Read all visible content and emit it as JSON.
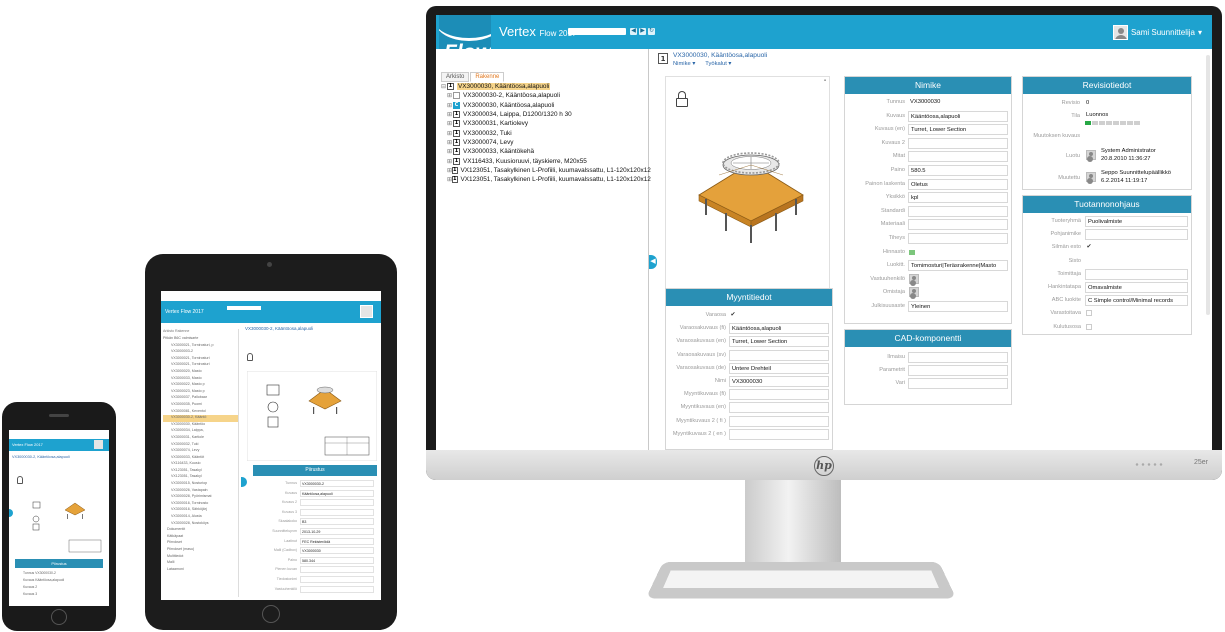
{
  "app": {
    "logo": "Flow",
    "title": "Vertex",
    "version": "Flow 2017",
    "toolbar_icons": [
      "back-icon",
      "forward-icon",
      "refresh-icon"
    ],
    "user_name": "Sami Suunnittelija",
    "user_menu_glyph": "▾"
  },
  "tabs": [
    "Arkisto",
    "Rakenne"
  ],
  "tree": [
    {
      "code": "VX3000030, Kääntöosa,alapuoli",
      "selected": true,
      "level": 0,
      "icon": "item"
    },
    {
      "code": "VX3000030-2, Kääntöosa,alapuoli",
      "level": 1,
      "icon": "doc"
    },
    {
      "code": "VX3000030, Kääntöosa,alapuoli",
      "level": 1,
      "icon": "cad"
    },
    {
      "code": "VX3000034, Laippa, D1200/1320 h 30",
      "level": 1,
      "icon": "item"
    },
    {
      "code": "VX3000031, Kartiolevy",
      "level": 1,
      "icon": "item"
    },
    {
      "code": "VX3000032, Tuki",
      "level": 1,
      "icon": "item"
    },
    {
      "code": "VX3000074, Levy",
      "level": 1,
      "icon": "item"
    },
    {
      "code": "VX3000033, Kääntökehä",
      "level": 1,
      "icon": "item"
    },
    {
      "code": "VX116433, Kuusioruuvi, täyskierre, M20x55",
      "level": 1,
      "icon": "item"
    },
    {
      "code": "VX123051, Tasakylkinen L-Profiili, kuumavalssattu, L1-120x120x12",
      "level": 1,
      "icon": "item"
    },
    {
      "code": "VX123051, Tasakylkinen L-Profiili, kuumavalssattu, L1-120x120x12",
      "level": 1,
      "icon": "item"
    }
  ],
  "header": {
    "title": "VX3000030, Kääntöosa,alapuoli",
    "menu1": "Nimike ▾",
    "menu2": "Työkalut ▾"
  },
  "nimike": {
    "title": "Nimike",
    "rows": [
      {
        "label": "Tunnus",
        "value": "VX3000030",
        "kind": "plain"
      },
      {
        "label": "Kuvaus",
        "value": "Kääntöosa,alapuoli",
        "kind": "box"
      },
      {
        "label": "Kuvaus (en)",
        "value": "Turret, Lower Section",
        "kind": "box"
      },
      {
        "label": "Kuvaus 2",
        "value": "",
        "kind": "box"
      },
      {
        "label": "Mitat",
        "value": "",
        "kind": "box"
      },
      {
        "label": "Paino",
        "value": "580.5",
        "kind": "box"
      },
      {
        "label": "Painon laskenta",
        "value": "Oletus",
        "kind": "box"
      },
      {
        "label": "Yksikkö",
        "value": "kpl",
        "kind": "box"
      },
      {
        "label": "Standardi",
        "value": "",
        "kind": "box"
      },
      {
        "label": "Materiaali",
        "value": "",
        "kind": "box"
      },
      {
        "label": "Tiheys",
        "value": "",
        "kind": "box"
      },
      {
        "label": "Hinnasto",
        "value": "",
        "kind": "green"
      },
      {
        "label": "Luokitt.",
        "value": "Tomimosturi|Teräsrakenne|Masto",
        "kind": "box"
      },
      {
        "label": "Vastuuhenkilö",
        "value": "",
        "kind": "avatar"
      },
      {
        "label": "Omistaja",
        "value": "",
        "kind": "avatar"
      },
      {
        "label": "Julkisuusaste",
        "value": "Yleinen",
        "kind": "box"
      }
    ]
  },
  "revisio": {
    "title": "Revisiotiedot",
    "revisio_label": "Revisio",
    "revisio_value": "0",
    "tila_label": "Tila",
    "tila_value": "Luonnos",
    "tila_progress": 0.125,
    "muutos_label": "Muutoksen kuvaus",
    "luotu_label": "Luotu",
    "luotu_user": "System Administrator",
    "luotu_date": "20.8.2010 11:36:27",
    "muutettu_label": "Muutettu",
    "muutettu_user": "Seppo Suunnittelupäällikkö",
    "muutettu_date": "6.2.2014 11:19:17"
  },
  "tuotanto": {
    "title": "Tuotannonohjaus",
    "rows": [
      {
        "label": "Tuoteryhmä",
        "value": "Puolivalmiste",
        "kind": "box"
      },
      {
        "label": "Pohjanimike",
        "value": "",
        "kind": "box"
      },
      {
        "label": "Silmän esto",
        "value": "✔",
        "kind": "check"
      },
      {
        "label": "Sisto",
        "value": "",
        "kind": "none"
      },
      {
        "label": "Toimittaja",
        "value": "",
        "kind": "box"
      },
      {
        "label": "Hankintatapa",
        "value": "Omavalmiste",
        "kind": "box"
      },
      {
        "label": "ABC luokite",
        "value": "C Simple control/Minimal records",
        "kind": "box"
      },
      {
        "label": "Varastoitava",
        "value": "",
        "kind": "checkoff"
      },
      {
        "label": "Kulutusosa",
        "value": "",
        "kind": "checkoff"
      }
    ]
  },
  "myynti": {
    "title": "Myyntitiedot",
    "rows": [
      {
        "label": "Varaosa",
        "value": "✔",
        "kind": "check"
      },
      {
        "label": "Varaosakuvaus (fi)",
        "value": "Kääntöosa,alapuoli",
        "kind": "box"
      },
      {
        "label": "Varaosakuvaus (en)",
        "value": "Turret, Lower Section",
        "kind": "box"
      },
      {
        "label": "Varaosakuvaus (sv)",
        "value": "",
        "kind": "box"
      },
      {
        "label": "Varaosakuvaus (de)",
        "value": "Untere Drehteil",
        "kind": "box"
      },
      {
        "label": "Nimi",
        "value": "VX3000030",
        "kind": "box"
      },
      {
        "label": "Myyntikuvaus (fi)",
        "value": "",
        "kind": "box"
      },
      {
        "label": "Myyntikuvaus (en)",
        "value": "",
        "kind": "box"
      },
      {
        "label": "Myyntikuvaus 2 ( fi )",
        "value": "",
        "kind": "box"
      },
      {
        "label": "Myyntikuvaus 2 ( en )",
        "value": "",
        "kind": "box"
      }
    ]
  },
  "cad": {
    "title": "CAD-komponentti",
    "rows": [
      {
        "label": "Ilmaisu",
        "value": ""
      },
      {
        "label": "Parametrit",
        "value": ""
      },
      {
        "label": "Vari",
        "value": ""
      }
    ]
  },
  "tablet": {
    "app_title": "Vertex Flow 2017",
    "item_title": "VX3000030-2, Kääntöosa,alapuoli",
    "panel_title": "Piirustus",
    "labels": [
      "Tunnus",
      "Kuvaus",
      "Kuvaus 2",
      "Kuvaus 3",
      "Skaalakoko",
      "Suunnittelupvm",
      "Laatinut",
      "Malli (Cadbox)",
      "Paino",
      "Pienen kuvan",
      "Tiedostonimi",
      "Vastuuhenkilö"
    ],
    "values": [
      "VX3000030-2",
      "Kääntöosa,alapuoli",
      "",
      "",
      "B3",
      "2013-10-29",
      "FEC Rekisteröidä",
      "VX3000030",
      "580.344",
      "",
      "",
      ""
    ],
    "tree": [
      "Pitkän B6C valmisarte",
      "VX3000021, Tornirosturi, p",
      "VX3000003-2",
      "VX3000021, Tornirosturi",
      "VX3000021, Tornirosturi",
      "VX3000020, Masto",
      "VX3000033, Masto",
      "VX3000022, Masto p",
      "VX3000023, Masto p",
      "VX3000037, Pallobaar",
      "VX3000035, Puomi",
      "VX3000081, Keventol",
      "VX3000030-2, Kääntö",
      "VX3000030, Kääntöo",
      "VX3000034, Laippa,",
      "VX3000031, Kartiole",
      "VX3000032, Tuki",
      "VX3000074, Levy",
      "VX3000033, Kääntöt",
      "VX116433, Kuusio",
      "VX123051, Tasakyl",
      "VX123051, Tasakyl",
      "VX3000015, Nosturiop",
      "VX3000026, Vastapain",
      "VX3000028, Pyörimismat",
      "VX3000016, Torninosto",
      "VX3000016, Sähköjärj",
      "VX3000014, Alusta",
      "VX3000028, Nostoköys",
      "Dokumentit",
      "Kätkäpaat",
      "Piirrokset",
      "Piirrokset (masu)",
      "Multitiedot",
      "Malli",
      "Lataamoni"
    ]
  },
  "phone": {
    "app_title": "Vertex Flow 2017",
    "item_title": "VX3000030-2, Kääntöosa,alapuoli",
    "panel_title": "Piirustus",
    "rows": [
      "Tunnus  VX3000030-2",
      "Kuvaus  Kääntöosa,alapuoli",
      "Kuvaus 2",
      "Kuvaus 3"
    ]
  },
  "brand": {
    "monitor_logo": "hp",
    "monitor_model": "25er",
    "accent": "#1ea2cf",
    "panel_header": "#2a8fb4"
  }
}
